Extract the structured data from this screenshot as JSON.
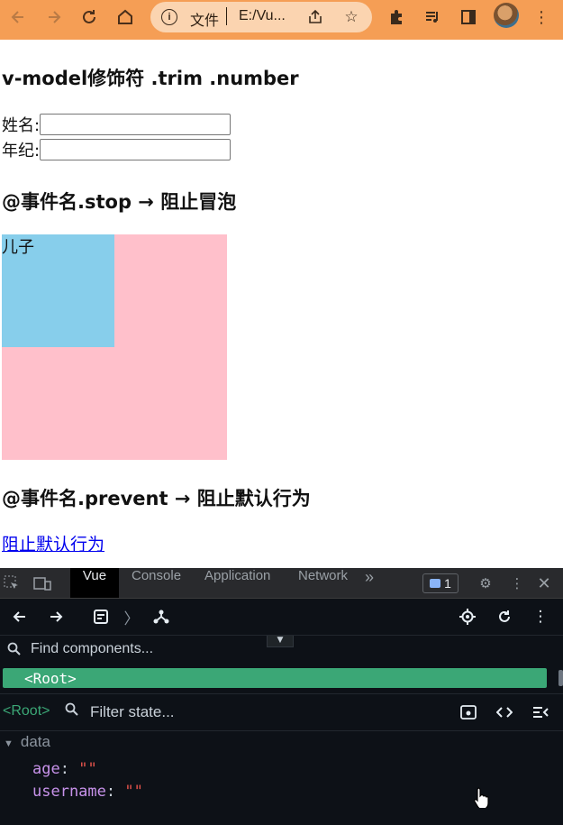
{
  "browser": {
    "page_label": "文件",
    "url": "E:/Vu...",
    "icons": [
      "back-arrow-icon",
      "forward-arrow-icon",
      "reload-icon",
      "home-icon",
      "info-icon",
      "share-icon",
      "star-icon",
      "extensions-puzzle-icon",
      "media-queue-icon",
      "sidepanel-icon",
      "profile-avatar",
      "kebab-menu-icon"
    ]
  },
  "page": {
    "heading_model": "v-model修饰符 .trim .number",
    "name_label": "姓名:",
    "name_value": "",
    "age_label": "年纪:",
    "age_value": "",
    "heading_stop": "@事件名.stop → 阻止冒泡",
    "son_label": "儿子",
    "heading_prevent": "@事件名.prevent → 阻止默认行为",
    "link_text": "阻止默认行为",
    "colors": {
      "father": "#ffc0cb",
      "son": "#87ceeb",
      "link": "#0000ee"
    }
  },
  "devtools": {
    "tabs": [
      "Vue",
      "Console",
      "Application",
      "Network"
    ],
    "active_tab": "Vue",
    "more_tabs": "»",
    "issues_count": "1",
    "find_placeholder": "Find components...",
    "root_component": "<Root>",
    "selected_label": "<Root>",
    "filter_placeholder": "Filter state...",
    "data_section": "data",
    "data": [
      {
        "key": "age",
        "value": "\"\""
      },
      {
        "key": "username",
        "value": "\"\""
      }
    ],
    "colors": {
      "accent": "#3ba776",
      "bg": "#0d1117"
    }
  }
}
